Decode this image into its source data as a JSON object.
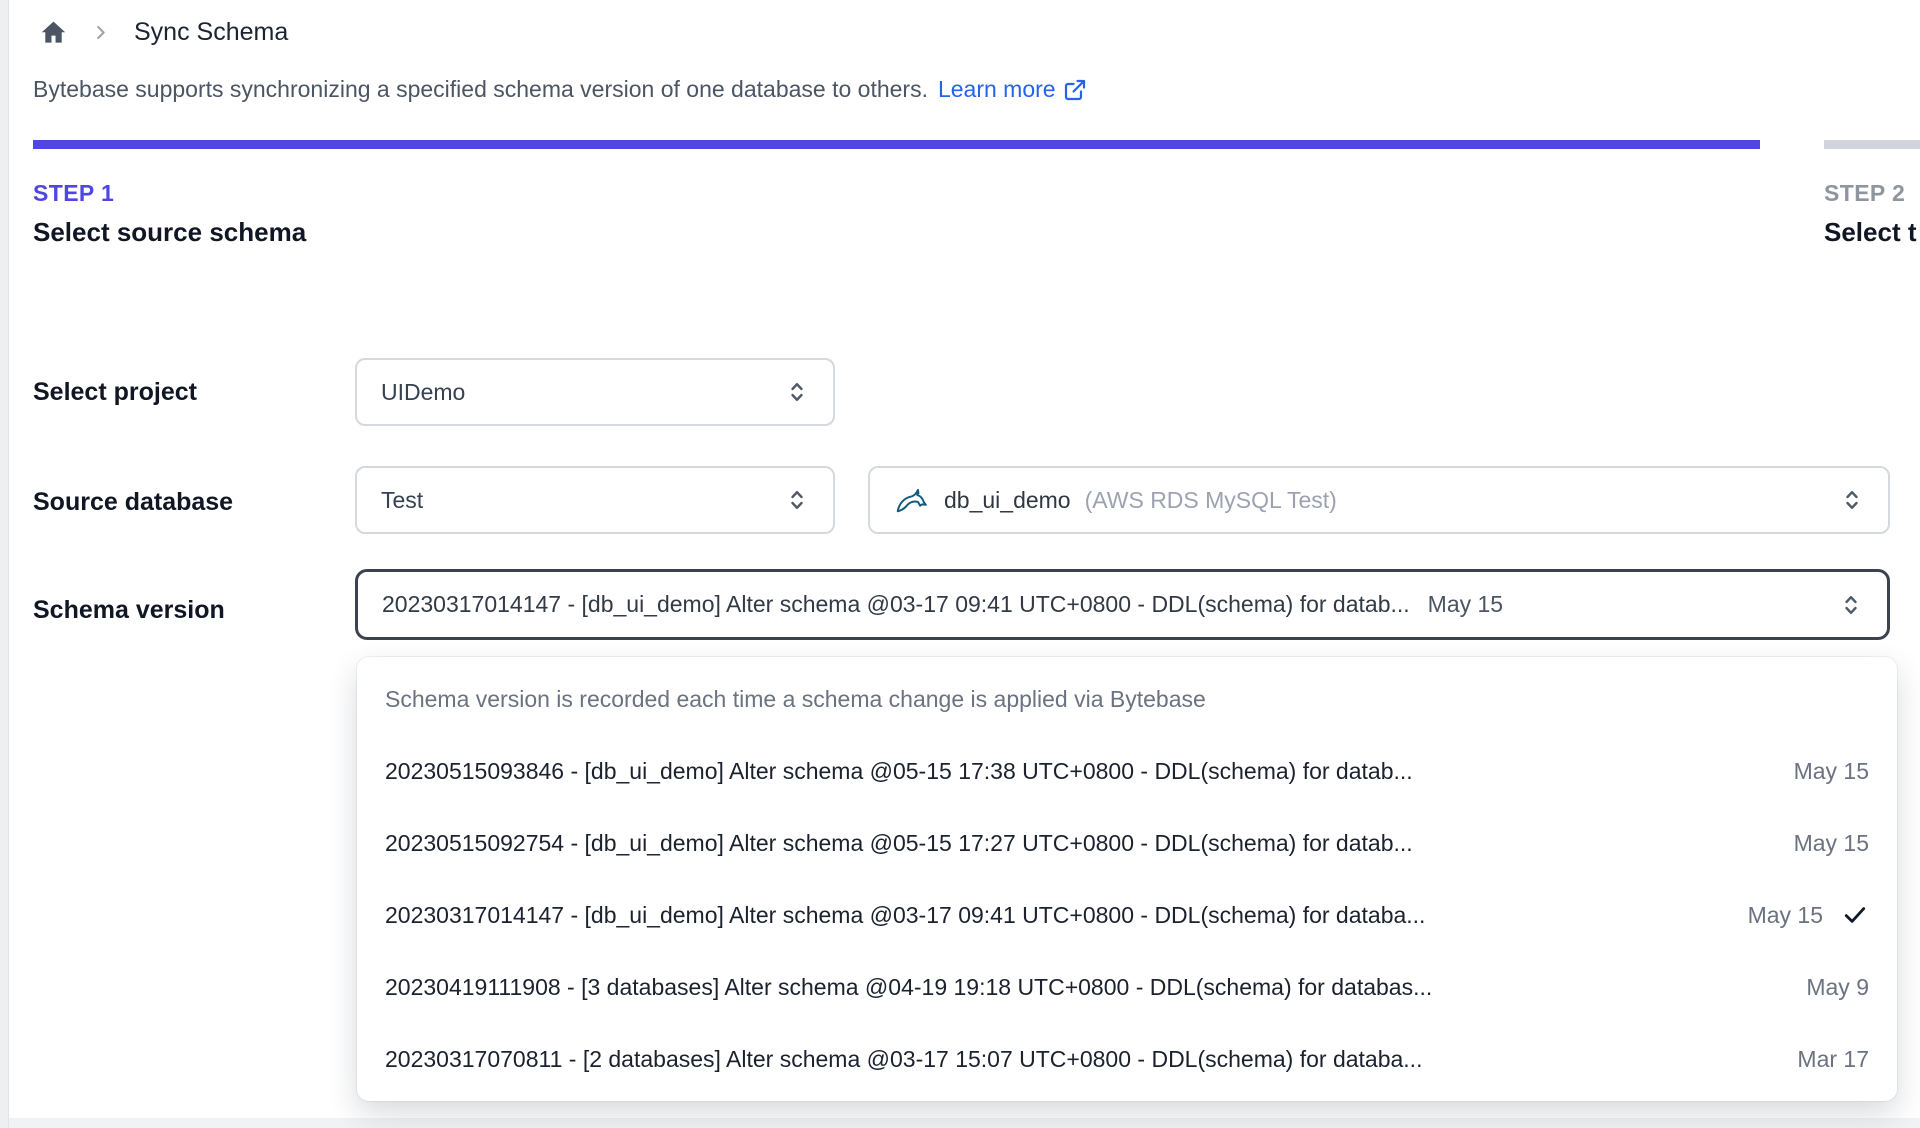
{
  "breadcrumb": {
    "title": "Sync Schema"
  },
  "description": {
    "text": "Bytebase supports synchronizing a specified schema version of one database to others.",
    "link_label": "Learn more"
  },
  "steps": [
    {
      "step": "STEP 1",
      "title": "Select source schema"
    },
    {
      "step": "STEP 2",
      "title": "Select t"
    }
  ],
  "form": {
    "project": {
      "label": "Select project",
      "value": "UIDemo"
    },
    "source_database": {
      "label": "Source database",
      "environment_value": "Test",
      "database_name": "db_ui_demo",
      "database_detail": "(AWS RDS MySQL Test)",
      "database_icon": "mysql-dolphin-icon"
    },
    "schema_version": {
      "label": "Schema version",
      "value": "20230317014147 - [db_ui_demo] Alter schema @03-17 09:41 UTC+0800 - DDL(schema) for datab...",
      "value_date": "May 15"
    }
  },
  "version_dropdown": {
    "hint": "Schema version is recorded each time a schema change is applied via Bytebase",
    "options": [
      {
        "text": "20230515093846 - [db_ui_demo] Alter schema @05-15 17:38 UTC+0800 - DDL(schema) for datab...",
        "date": "May 15",
        "selected": false
      },
      {
        "text": "20230515092754 - [db_ui_demo] Alter schema @05-15 17:27 UTC+0800 - DDL(schema) for datab...",
        "date": "May 15",
        "selected": false
      },
      {
        "text": "20230317014147 - [db_ui_demo] Alter schema @03-17 09:41 UTC+0800 - DDL(schema) for databa...",
        "date": "May 15",
        "selected": true
      },
      {
        "text": "20230419111908 - [3 databases] Alter schema @04-19 19:18 UTC+0800 - DDL(schema) for databas...",
        "date": "May 9",
        "selected": false
      },
      {
        "text": "20230317070811 - [2 databases] Alter schema @03-17 15:07 UTC+0800 - DDL(schema) for databa...",
        "date": "Mar 17",
        "selected": false
      }
    ]
  },
  "colors": {
    "accent_indigo": "#4f46e5",
    "link_blue": "#2563eb",
    "inactive_gray": "#d1d5db",
    "focus_border": "#3b4350",
    "mysql_teal": "#00618a"
  }
}
